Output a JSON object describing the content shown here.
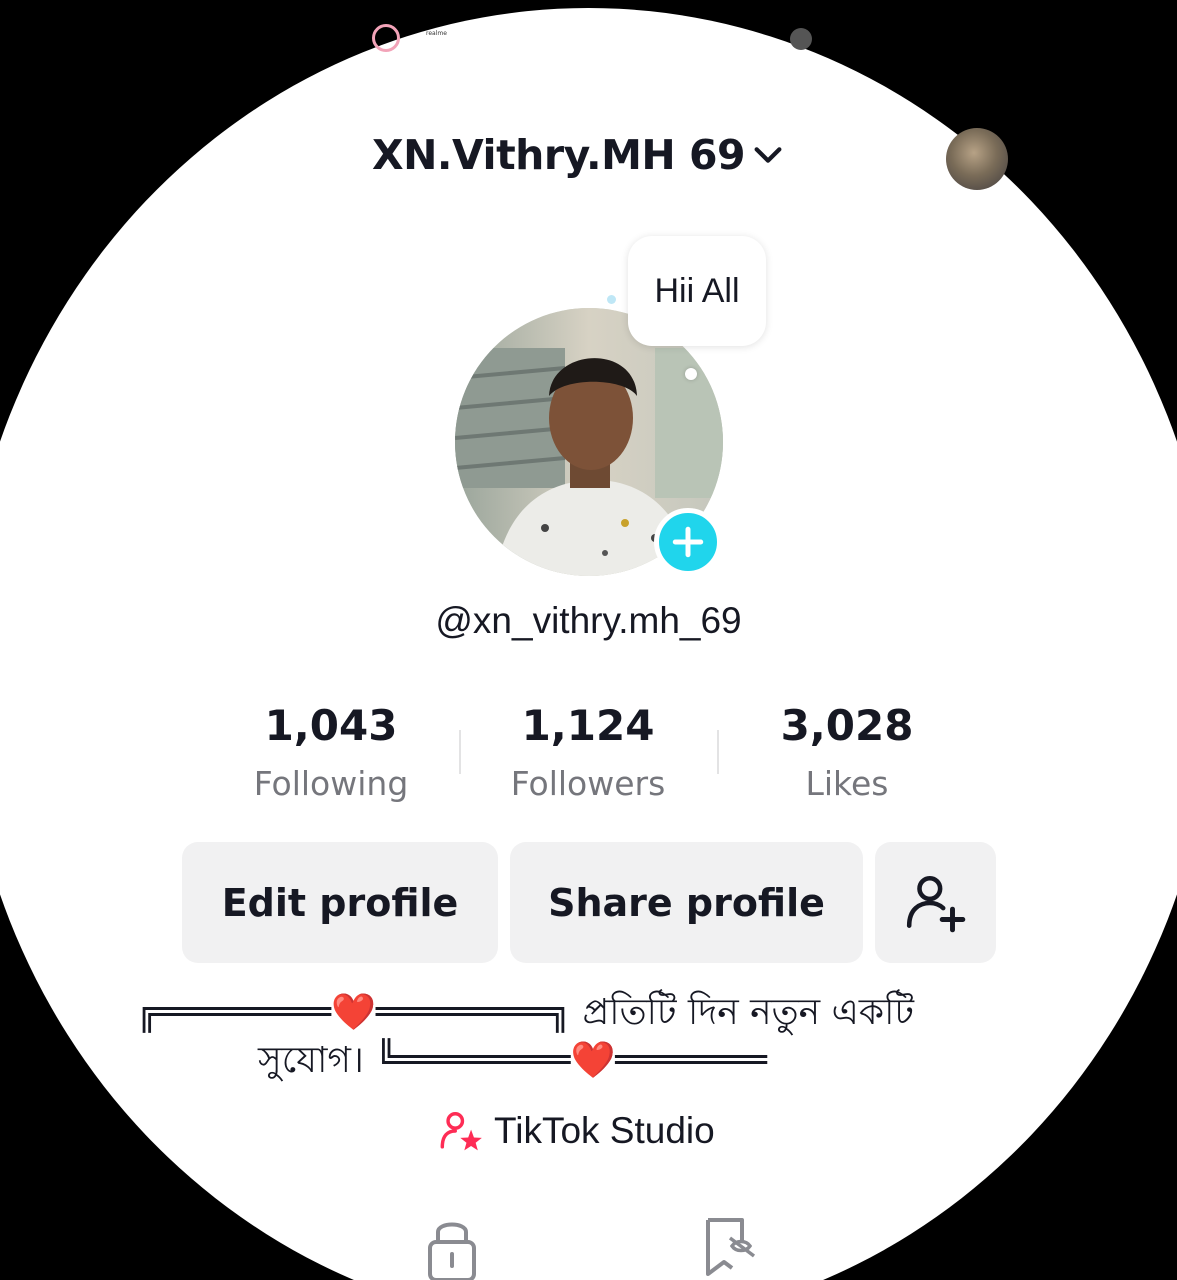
{
  "status_bar": {
    "logo_caption": "realme"
  },
  "header": {
    "title": "XN.Vithry.MH 69"
  },
  "profile": {
    "note": "Hii All",
    "handle": "@xn_vithry.mh_69"
  },
  "stats": [
    {
      "value": "1,043",
      "label": "Following"
    },
    {
      "value": "1,124",
      "label": "Followers"
    },
    {
      "value": "3,028",
      "label": "Likes"
    }
  ],
  "actions": {
    "edit_label": "Edit profile",
    "share_label": "Share profile"
  },
  "bio": {
    "line1_prefix": "╔════════",
    "line1_mid": "❤️",
    "line1_suffix": "════════╗",
    "line1_text": "প্রতিটি দিন নতুন একটি",
    "line2_text": "সুযোগ।",
    "line2_prefix": "╚════════",
    "line2_mid": "❤️",
    "line2_suffix": "═══════"
  },
  "studio": {
    "label": "TikTok Studio"
  },
  "colors": {
    "accent_cyan": "#20d5ec",
    "studio_pink": "#fe2c55",
    "text_primary": "#161823",
    "text_secondary": "#75767c",
    "button_bg": "#f1f1f2"
  },
  "icons": [
    "chevron-down-icon",
    "plus-icon",
    "add-friend-icon",
    "studio-icon",
    "lock-icon",
    "repost-icon",
    "heart-icon"
  ]
}
